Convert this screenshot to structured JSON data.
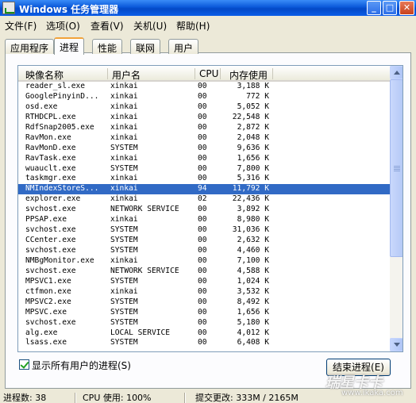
{
  "window": {
    "title": "Windows 任务管理器",
    "minimize_label": "_",
    "maximize_label": "□",
    "close_label": "✕"
  },
  "menubar": {
    "items": [
      {
        "label": "文件(F)"
      },
      {
        "label": "选项(O)"
      },
      {
        "label": "查看(V)"
      },
      {
        "label": "关机(U)"
      },
      {
        "label": "帮助(H)"
      }
    ]
  },
  "tabs": [
    {
      "label": "应用程序",
      "active": false
    },
    {
      "label": "进程",
      "active": true
    },
    {
      "label": "性能",
      "active": false
    },
    {
      "label": "联网",
      "active": false
    },
    {
      "label": "用户",
      "active": false
    }
  ],
  "process_list": {
    "columns": [
      {
        "label": "映像名称"
      },
      {
        "label": "用户名"
      },
      {
        "label": "CPU"
      },
      {
        "label": "内存使用"
      }
    ],
    "selected_index": 10,
    "rows": [
      {
        "name": "reader_sl.exe",
        "user": "xinkai",
        "cpu": "00",
        "mem": "3,188 K"
      },
      {
        "name": "GooglePinyinD...",
        "user": "xinkai",
        "cpu": "00",
        "mem": "772 K"
      },
      {
        "name": "osd.exe",
        "user": "xinkai",
        "cpu": "00",
        "mem": "5,052 K"
      },
      {
        "name": "RTHDCPL.exe",
        "user": "xinkai",
        "cpu": "00",
        "mem": "22,548 K"
      },
      {
        "name": "RdfSnap2005.exe",
        "user": "xinkai",
        "cpu": "00",
        "mem": "2,872 K"
      },
      {
        "name": "RavMon.exe",
        "user": "xinkai",
        "cpu": "00",
        "mem": "2,048 K"
      },
      {
        "name": "RavMonD.exe",
        "user": "SYSTEM",
        "cpu": "00",
        "mem": "9,636 K"
      },
      {
        "name": "RavTask.exe",
        "user": "xinkai",
        "cpu": "00",
        "mem": "1,656 K"
      },
      {
        "name": "wuauclt.exe",
        "user": "SYSTEM",
        "cpu": "00",
        "mem": "7,800 K"
      },
      {
        "name": "taskmgr.exe",
        "user": "xinkai",
        "cpu": "00",
        "mem": "5,316 K"
      },
      {
        "name": "NMIndexStoreS...",
        "user": "xinkai",
        "cpu": "94",
        "mem": "11,792 K"
      },
      {
        "name": "explorer.exe",
        "user": "xinkai",
        "cpu": "02",
        "mem": "22,436 K"
      },
      {
        "name": "svchost.exe",
        "user": "NETWORK SERVICE",
        "cpu": "00",
        "mem": "3,892 K"
      },
      {
        "name": "PPSAP.exe",
        "user": "xinkai",
        "cpu": "00",
        "mem": "8,980 K"
      },
      {
        "name": "svchost.exe",
        "user": "SYSTEM",
        "cpu": "00",
        "mem": "31,036 K"
      },
      {
        "name": "CCenter.exe",
        "user": "SYSTEM",
        "cpu": "00",
        "mem": "2,632 K"
      },
      {
        "name": "svchost.exe",
        "user": "SYSTEM",
        "cpu": "00",
        "mem": "4,460 K"
      },
      {
        "name": "NMBgMonitor.exe",
        "user": "xinkai",
        "cpu": "00",
        "mem": "7,100 K"
      },
      {
        "name": "svchost.exe",
        "user": "NETWORK SERVICE",
        "cpu": "00",
        "mem": "4,588 K"
      },
      {
        "name": "MPSVC1.exe",
        "user": "SYSTEM",
        "cpu": "00",
        "mem": "1,024 K"
      },
      {
        "name": "ctfmon.exe",
        "user": "xinkai",
        "cpu": "00",
        "mem": "3,532 K"
      },
      {
        "name": "MPSVC2.exe",
        "user": "SYSTEM",
        "cpu": "00",
        "mem": "8,492 K"
      },
      {
        "name": "MPSVC.exe",
        "user": "SYSTEM",
        "cpu": "00",
        "mem": "1,656 K"
      },
      {
        "name": "svchost.exe",
        "user": "SYSTEM",
        "cpu": "00",
        "mem": "5,180 K"
      },
      {
        "name": "alg.exe",
        "user": "LOCAL SERVICE",
        "cpu": "00",
        "mem": "4,012 K"
      },
      {
        "name": "lsass.exe",
        "user": "SYSTEM",
        "cpu": "00",
        "mem": "6,408 K"
      }
    ]
  },
  "show_all_users": {
    "label": "显示所有用户的进程(S)",
    "checked": true
  },
  "end_process_button": {
    "label": "结束进程(E)"
  },
  "statusbar": {
    "processes": "进程数: 38",
    "cpu": "CPU 使用: 100%",
    "commit": "提交更改: 333M / 2165M"
  },
  "watermark": {
    "main": "瑞星卡卡",
    "url": "www.ikaka.com"
  },
  "colors": {
    "selection": "#316ac5",
    "titlebar": "#0a58d9",
    "tab_highlight": "#f2a33a"
  }
}
